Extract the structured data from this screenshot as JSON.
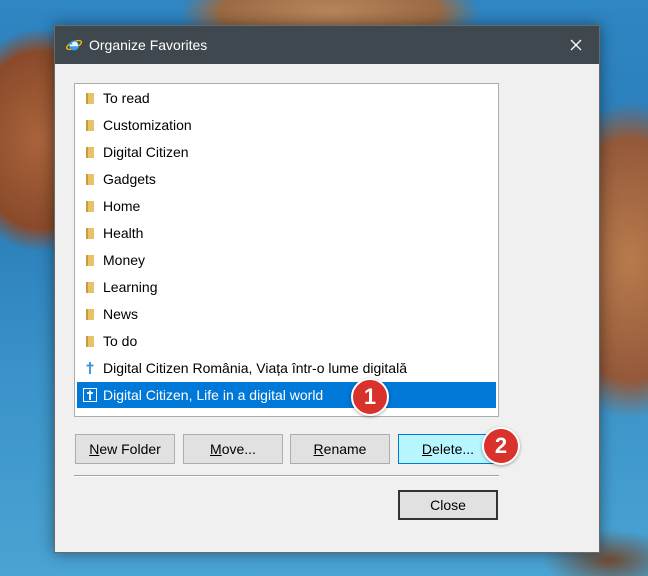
{
  "window": {
    "title": "Organize Favorites",
    "app_icon": "internet-explorer-icon",
    "close_icon": "close-icon"
  },
  "favorites": {
    "items": [
      {
        "label": "To read",
        "icon": "folder-icon",
        "type": "folder"
      },
      {
        "label": "Customization",
        "icon": "folder-icon",
        "type": "folder"
      },
      {
        "label": "Digital Citizen",
        "icon": "folder-icon",
        "type": "folder"
      },
      {
        "label": "Gadgets",
        "icon": "folder-icon",
        "type": "folder"
      },
      {
        "label": "Home",
        "icon": "folder-icon",
        "type": "folder"
      },
      {
        "label": "Health",
        "icon": "folder-icon",
        "type": "folder"
      },
      {
        "label": "Money",
        "icon": "folder-icon",
        "type": "folder"
      },
      {
        "label": "Learning",
        "icon": "folder-icon",
        "type": "folder"
      },
      {
        "label": "News",
        "icon": "folder-icon",
        "type": "folder"
      },
      {
        "label": "To do",
        "icon": "folder-icon",
        "type": "folder"
      },
      {
        "label": "Digital Citizen România, Viața într-o lume digitală",
        "icon": "site-favicon-icon",
        "type": "link"
      },
      {
        "label": "Digital Citizen, Life in a digital world",
        "icon": "site-favicon-icon",
        "type": "link",
        "selected": true
      }
    ]
  },
  "buttons": {
    "new_folder": {
      "accel": "N",
      "rest": "ew Folder"
    },
    "move": {
      "accel": "M",
      "rest": "ove..."
    },
    "rename": {
      "accel": "R",
      "rest": "ename"
    },
    "delete": {
      "accel": "D",
      "rest": "elete..."
    },
    "close": "Close"
  },
  "callouts": {
    "first": "1",
    "second": "2"
  },
  "colors": {
    "titlebar": "#3f484e",
    "selection": "#0078d7",
    "focused_button": "#b8f6ff",
    "callout": "#d9312b",
    "folder": "#e8c268"
  }
}
